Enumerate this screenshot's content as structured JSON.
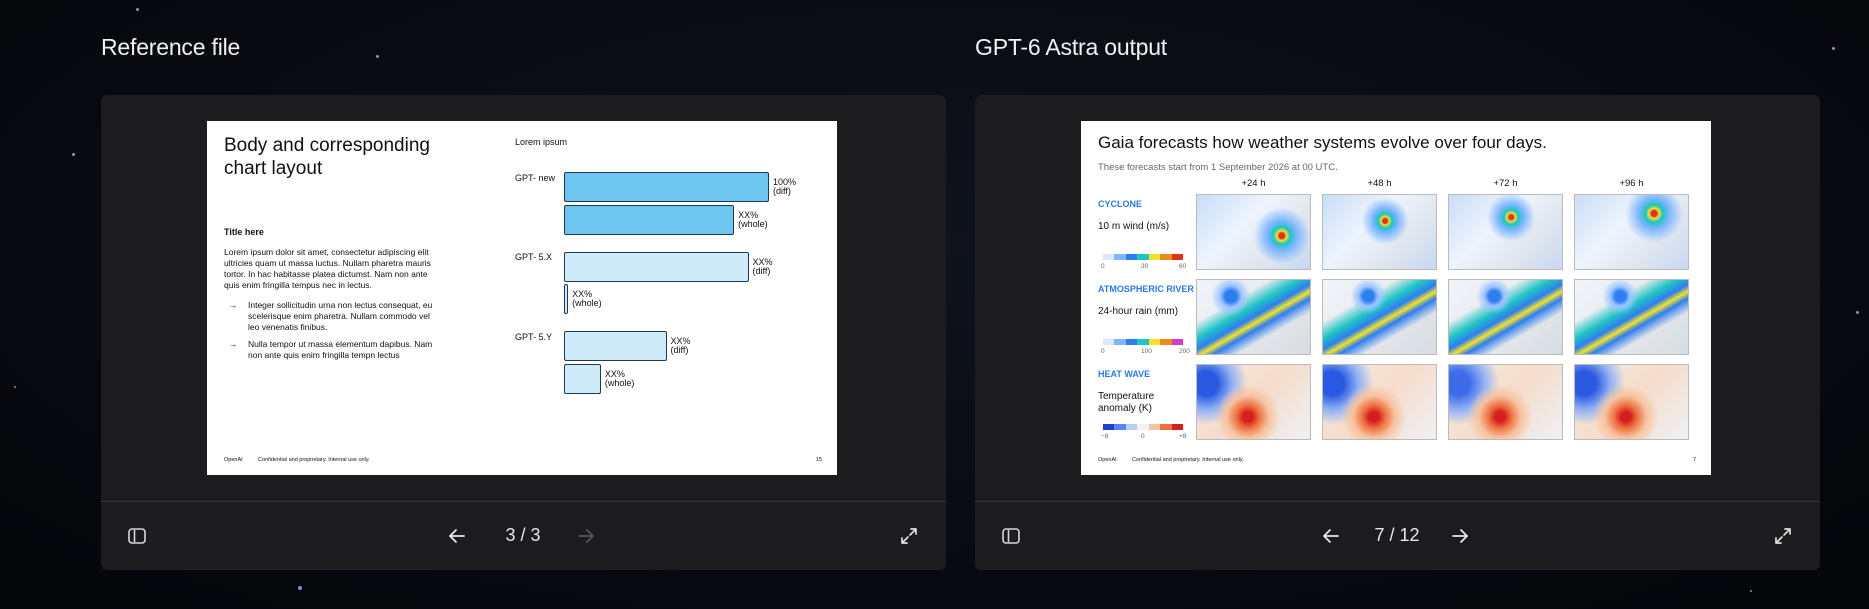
{
  "left_panel": {
    "title": "Reference file",
    "counter": "3 / 3",
    "slide": {
      "title": "Body and corresponding chart layout",
      "subtitle": "Title here",
      "body": "Lorem ipsum dolor sit amet, consectetur adipiscing elit ultricies quam ut massa luctus. Nullam pharetra mauris tortor. In hac habitasse platea dictumst. Nam non ante quis enim fringilla tempus nec in lectus.",
      "bullets": [
        "Integer sollicitudin urna non lectus consequat, eu scelerisque enim pharetra. Nullam commodo vel leo venenatis finibus.",
        "Nulla tempor ut massa elementum dapibus. Nam non ante quis enim fringilla tempn lectus"
      ],
      "footer_brand": "OpenAI",
      "footer_note": "Confidential and proprietary. Internal use only.",
      "page_number": "15",
      "chart_data": {
        "type": "bar",
        "title": "Lorem ipsum",
        "categories": [
          "GPT- new",
          "GPT- 5.X",
          "GPT- 5.Y"
        ],
        "bars": [
          {
            "group": "GPT- new",
            "label": "100% (diff)",
            "value": 100,
            "color": "#6ec6f0"
          },
          {
            "group": "GPT- new",
            "label": "XX% (whole)",
            "value": 83,
            "color": "#6ec6f0"
          },
          {
            "group": "GPT- 5.X",
            "label": "XX% (diff)",
            "value": 90,
            "color": "#cfeaf8"
          },
          {
            "group": "GPT- 5.X",
            "label": "XX% (whole)",
            "value": 2,
            "color": "#cfeaf8"
          },
          {
            "group": "GPT- 5.Y",
            "label": "XX% (diff)",
            "value": 50,
            "color": "#cfeaf8"
          },
          {
            "group": "GPT- 5.Y",
            "label": "XX% (whole)",
            "value": 18,
            "color": "#cfeaf8"
          }
        ]
      }
    }
  },
  "right_panel": {
    "title": "GPT-6 Astra output",
    "counter": "7 / 12",
    "slide": {
      "title": "Gaia forecasts how weather systems evolve over four days.",
      "subtitle": "These forecasts start from 1 September 2026 at 00 UTC.",
      "columns": [
        "+24 h",
        "+48 h",
        "+72 h",
        "+96 h"
      ],
      "rows": [
        {
          "tag": "CYCLONE",
          "variable": "10 m wind (m/s)",
          "ticks": [
            "0",
            "30",
            "60"
          ],
          "colormap": [
            "#d9e8ff",
            "#7fb6ff",
            "#2f7ef0",
            "#1fc4c4",
            "#f2e22a",
            "#f08a1c",
            "#e0301e"
          ]
        },
        {
          "tag": "ATMOSPHERIC RIVER",
          "variable": "24-hour rain (mm)",
          "ticks": [
            "0",
            "100",
            "200"
          ],
          "colormap": [
            "#d9e8ff",
            "#7fb6ff",
            "#2f7ef0",
            "#1fc4c4",
            "#f2e22a",
            "#f08a1c",
            "#d63ac7"
          ]
        },
        {
          "tag": "HEAT WAVE",
          "variable": "Temperature anomaly (K)",
          "ticks": [
            "−8",
            "0",
            "+8"
          ],
          "colormap": [
            "#1f3fd0",
            "#5a86f0",
            "#b8cdf8",
            "#f2f2f2",
            "#f6c3a0",
            "#ee7040",
            "#d61e1e"
          ]
        }
      ],
      "footer_brand": "OpenAI",
      "footer_note": "Confidential and proprietary. Internal use only.",
      "page_number": "7"
    }
  },
  "icons": {
    "sidebar": "sidebar-toggle-icon",
    "prev": "arrow-left-icon",
    "next": "arrow-right-icon",
    "expand": "expand-icon"
  }
}
